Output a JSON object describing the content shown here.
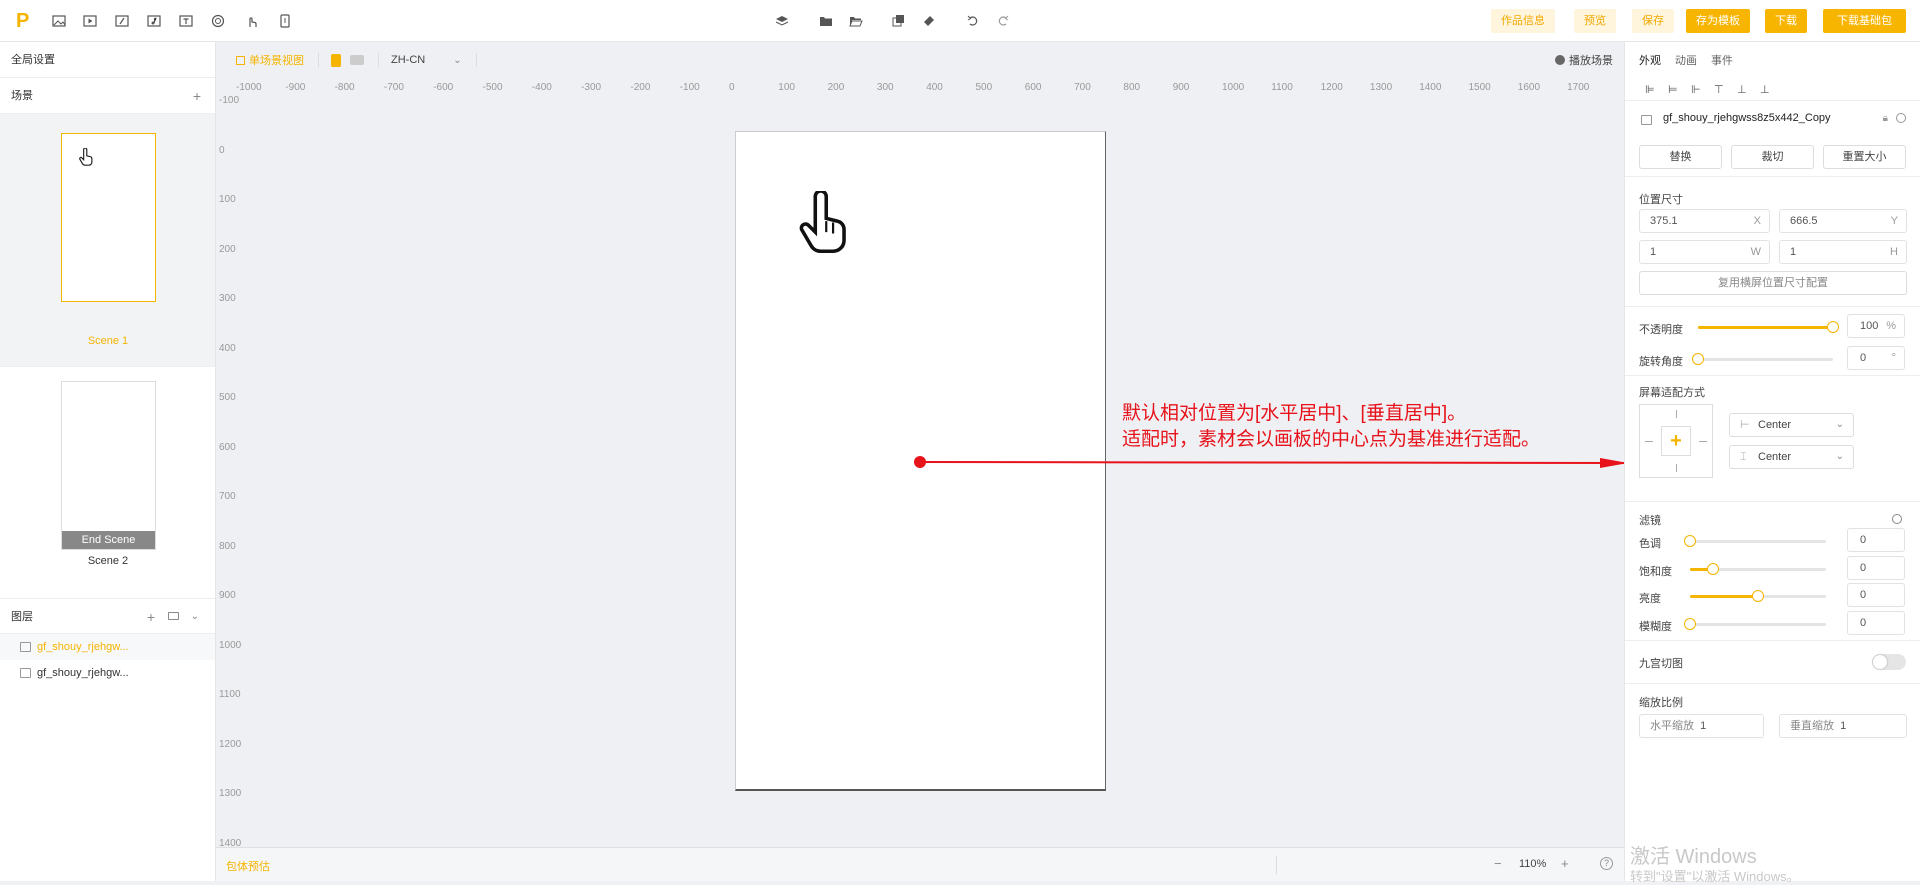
{
  "topbar": {
    "logo": "P",
    "buttons": {
      "work_info": "作品信息",
      "preview": "预览",
      "save": "保存",
      "save_template": "存为模板",
      "download": "下载",
      "download_base": "下载基础包"
    }
  },
  "left": {
    "global_settings": "全局设置",
    "scenes_title": "场景",
    "scene1_label": "Scene 1",
    "end_scene_tag": "End Scene",
    "scene2_label": "Scene 2",
    "layers_title": "图层",
    "layers": [
      "gf_shouy_rjehgw...",
      "gf_shouy_rjehgw..."
    ]
  },
  "canvas": {
    "single_scene_view": "单场景视图",
    "language": "ZH-CN",
    "play_scene": "播放场景",
    "ruler_h": [
      "-1000",
      "-900",
      "-800",
      "-700",
      "-600",
      "-500",
      "-400",
      "-300",
      "-200",
      "-100",
      "0",
      "100",
      "200",
      "300",
      "400",
      "500",
      "600",
      "700",
      "800",
      "900",
      "1000",
      "1100",
      "1200",
      "1300",
      "1400",
      "1500",
      "1600",
      "1700"
    ],
    "ruler_v": [
      "-100",
      "0",
      "100",
      "200",
      "300",
      "400",
      "500",
      "600",
      "700",
      "800",
      "900",
      "1000",
      "1100",
      "1200",
      "1300",
      "1400"
    ],
    "annotation_line1": "默认相对位置为[水平居中]、[垂直居中]。",
    "annotation_line2": "适配时，素材会以画板的中心点为基准进行适配。",
    "package_estimate": "包体预估",
    "zoom": "110%",
    "zoom_minus": "−",
    "zoom_plus": "+",
    "help": "?"
  },
  "right": {
    "tabs": [
      "外观",
      "动画",
      "事件"
    ],
    "element_name": "gf_shouy_rjehgwss8z5x442_Copy",
    "replace": "替换",
    "crop": "裁切",
    "reset_size": "重置大小",
    "pos_size_title": "位置尺寸",
    "x_value": "375.1",
    "x_label": "X",
    "y_value": "666.5",
    "y_label": "Y",
    "w_value": "1",
    "w_label": "W",
    "h_value": "1",
    "h_label": "H",
    "reuse_landscape": "复用横屏位置尺寸配置",
    "opacity_label": "不透明度",
    "opacity_value": "100",
    "opacity_unit": "%",
    "opacity_level": 1.0,
    "rotation_label": "旋转角度",
    "rotation_value": "0",
    "rotation_unit": "°",
    "rotation_level": 0.0,
    "adapt_title": "屏幕适配方式",
    "adapt_h": "Center",
    "adapt_v": "Center",
    "filter_title": "滤镜",
    "filters": [
      {
        "label": "色调",
        "value": "0",
        "level": 0.0,
        "fill": false
      },
      {
        "label": "饱和度",
        "value": "0",
        "level": 0.17,
        "fill": true
      },
      {
        "label": "亮度",
        "value": "0",
        "level": 0.5,
        "fill": true
      },
      {
        "label": "模糊度",
        "value": "0",
        "level": 0.0,
        "fill": false
      }
    ],
    "nine_slice": "九宫切图",
    "scale_title": "缩放比例",
    "scale_h_label": "水平缩放",
    "scale_h_value": "1",
    "scale_v_label": "垂直缩放",
    "scale_v_value": "1"
  },
  "watermark": {
    "line1": "激活 Windows",
    "line2": "转到\"设置\"以激活 Windows。"
  },
  "colors": {
    "accent": "#f5b400",
    "annotation": "#e8121b"
  }
}
